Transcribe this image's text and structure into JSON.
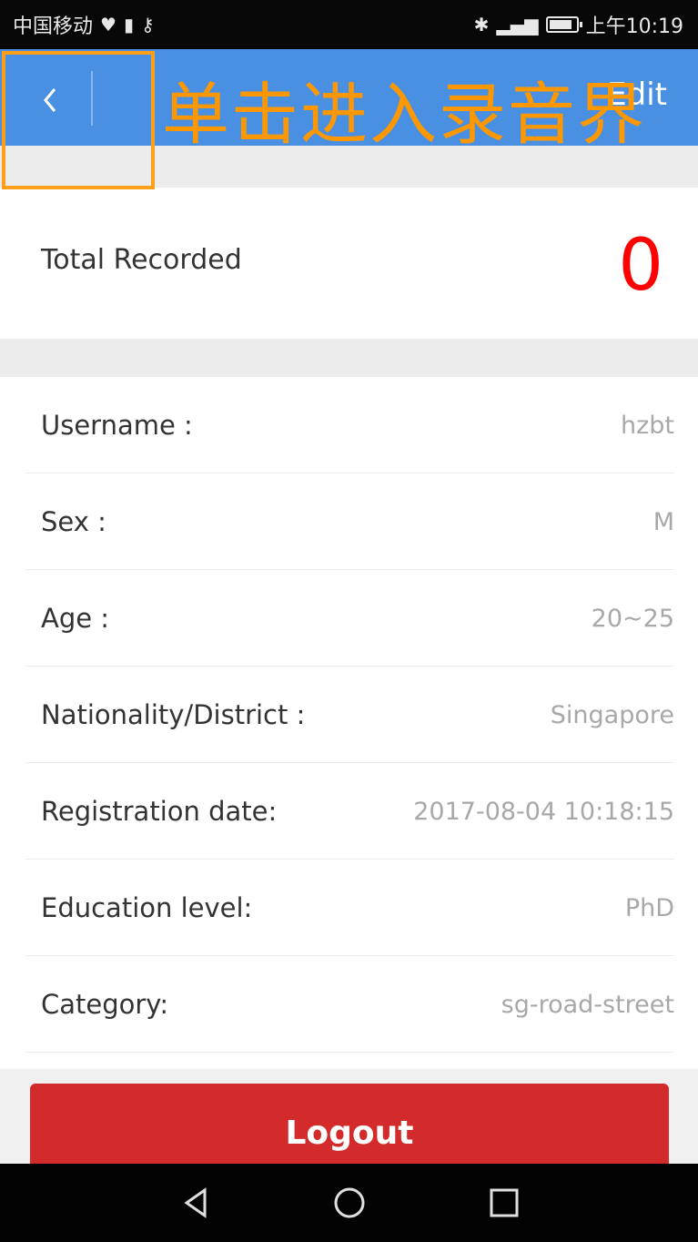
{
  "status_bar": {
    "carrier": "中国移动",
    "time": "上午10:19"
  },
  "header": {
    "back_icon": "chevron-left-icon",
    "edit_label": "Edit"
  },
  "stats": {
    "total_label": "Total Recorded",
    "total_value": "0",
    "value_color": "#ff0000"
  },
  "profile": {
    "rows": [
      {
        "label": "Username :",
        "value": "hzbt"
      },
      {
        "label": "Sex :",
        "value": "M"
      },
      {
        "label": "Age :",
        "value": "20~25"
      },
      {
        "label": "Nationality/District :",
        "value": "Singapore"
      },
      {
        "label": "Registration date:",
        "value": "2017-08-04 10:18:15"
      },
      {
        "label": "Education level:",
        "value": "PhD"
      },
      {
        "label": "Category:",
        "value": "sg-road-street"
      }
    ]
  },
  "logout_label": "Logout",
  "annotation": {
    "text": "单击进入录音界",
    "color": "#ff9800"
  },
  "colors": {
    "header": "#4a90e2",
    "logout": "#d32b2b"
  }
}
